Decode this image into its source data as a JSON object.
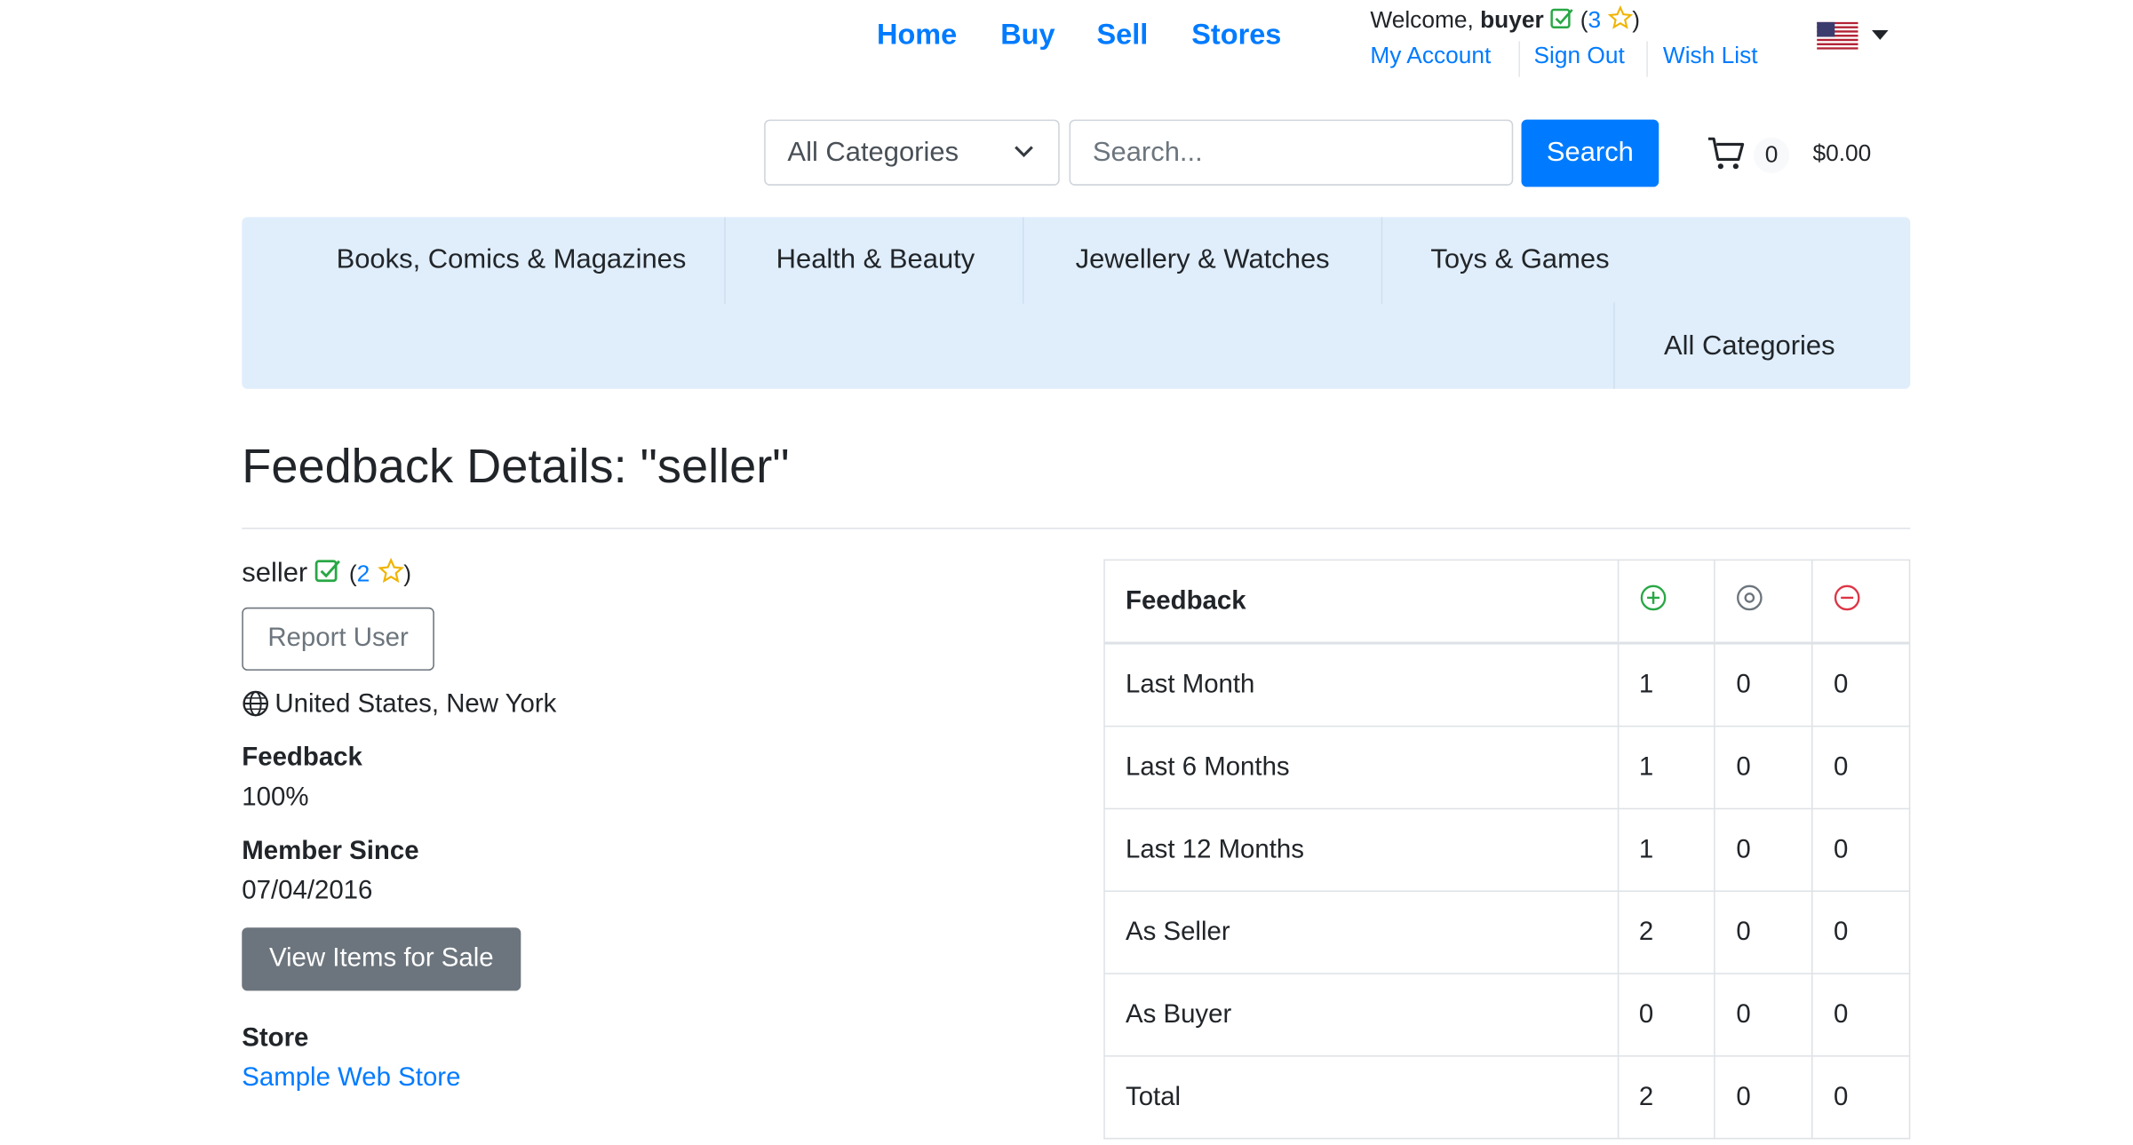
{
  "nav": {
    "links": [
      "Home",
      "Buy",
      "Sell",
      "Stores"
    ],
    "welcome_prefix": "Welcome,",
    "username": "buyer",
    "rating_open": "(",
    "rating": "3",
    "rating_close": ")",
    "account_links": [
      "My Account",
      "Sign Out",
      "Wish List"
    ],
    "locale_flag_icon": "us-flag-icon"
  },
  "search": {
    "category_selected": "All Categories",
    "placeholder": "Search...",
    "button": "Search",
    "cart_count": "0",
    "cart_total": "$0.00"
  },
  "categories": [
    "Books, Comics & Magazines",
    "Health & Beauty",
    "Jewellery & Watches",
    "Toys & Games",
    "All Categories"
  ],
  "page": {
    "title": "Feedback Details: \"seller\""
  },
  "profile": {
    "username": "seller",
    "rating_open": "(",
    "rating": "2",
    "rating_close": ")",
    "report_button": "Report User",
    "location": "United States, New York",
    "feedback_label": "Feedback",
    "feedback_value": "100%",
    "member_label": "Member Since",
    "member_value": "07/04/2016",
    "items_button": "View Items for Sale",
    "store_label": "Store",
    "store_link": "Sample Web Store"
  },
  "feedback_table": {
    "header": "Feedback",
    "columns_icons": [
      "positive-icon",
      "neutral-icon",
      "negative-icon"
    ],
    "colors": {
      "positive": "#28a745",
      "neutral": "#6c757d",
      "negative": "#dc3545"
    },
    "rows": [
      {
        "label": "Last Month",
        "values": [
          "1",
          "0",
          "0"
        ]
      },
      {
        "label": "Last 6 Months",
        "values": [
          "1",
          "0",
          "0"
        ]
      },
      {
        "label": "Last 12 Months",
        "values": [
          "1",
          "0",
          "0"
        ]
      },
      {
        "label": "As Seller",
        "values": [
          "2",
          "0",
          "0"
        ]
      },
      {
        "label": "As Buyer",
        "values": [
          "0",
          "0",
          "0"
        ]
      },
      {
        "label": "Total",
        "values": [
          "2",
          "0",
          "0"
        ]
      }
    ]
  }
}
